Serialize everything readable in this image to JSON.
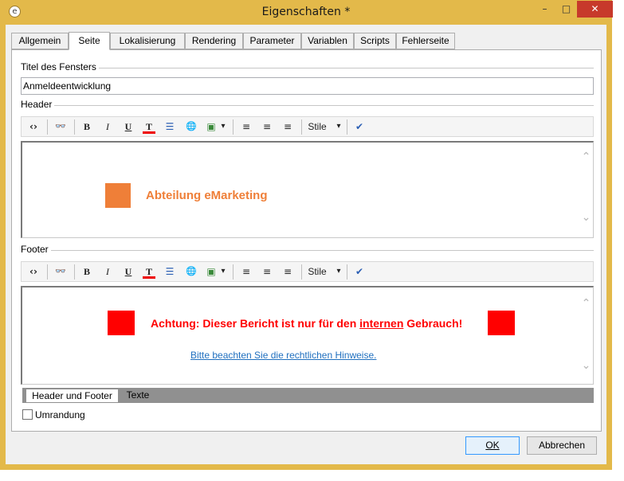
{
  "window": {
    "title": "Eigenschaften *",
    "app_icon": "app-icon",
    "controls": {
      "minimize": "–",
      "maximize": "□",
      "close": "✕"
    }
  },
  "tabs": [
    {
      "label": "Allgemein",
      "active": false
    },
    {
      "label": "Seite",
      "active": true
    },
    {
      "label": "Lokalisierung",
      "active": false
    },
    {
      "label": "Rendering",
      "active": false
    },
    {
      "label": "Parameter",
      "active": false
    },
    {
      "label": "Variablen",
      "active": false
    },
    {
      "label": "Scripts",
      "active": false
    },
    {
      "label": "Fehlerseite",
      "active": false
    }
  ],
  "page": {
    "window_title_label": "Titel des Fensters",
    "window_title_value": "Anmeldeentwicklung",
    "header_label": "Header",
    "footer_label": "Footer"
  },
  "toolbar": {
    "source_icon": "‹›",
    "find_icon": "👓",
    "bold": "B",
    "italic": "I",
    "underline": "U",
    "text_color": "T",
    "list_icon": "☰",
    "link_icon": "🌐",
    "image_icon": "▣",
    "image_dropdown": "▾",
    "align_left": "≡",
    "align_center": "≡",
    "align_right": "≡",
    "style_label": "Stile",
    "style_dropdown": "▾",
    "spellcheck_icon": "✔"
  },
  "header_content": {
    "text": "Abteilung eMarketing",
    "color": "#ef7f38"
  },
  "footer_content": {
    "warning_prefix": "Achtung: Dieser Bericht ist nur für den ",
    "warning_underlined": "internen",
    "warning_suffix": " Gebrauch!",
    "warning_color": "#ff0000",
    "link_text": "Bitte beachten Sie die rechtlichen Hinweise.",
    "link_color": "#1f6fbf"
  },
  "scrollbar": {
    "up": "⌃",
    "down": "⌄"
  },
  "bottom_tabs": [
    {
      "label": "Header und Footer",
      "active": true
    },
    {
      "label": "Texte",
      "active": false
    }
  ],
  "options": {
    "border_label": "Umrandung",
    "border_checked": false
  },
  "buttons": {
    "ok": "OK",
    "cancel": "Abbrechen"
  }
}
